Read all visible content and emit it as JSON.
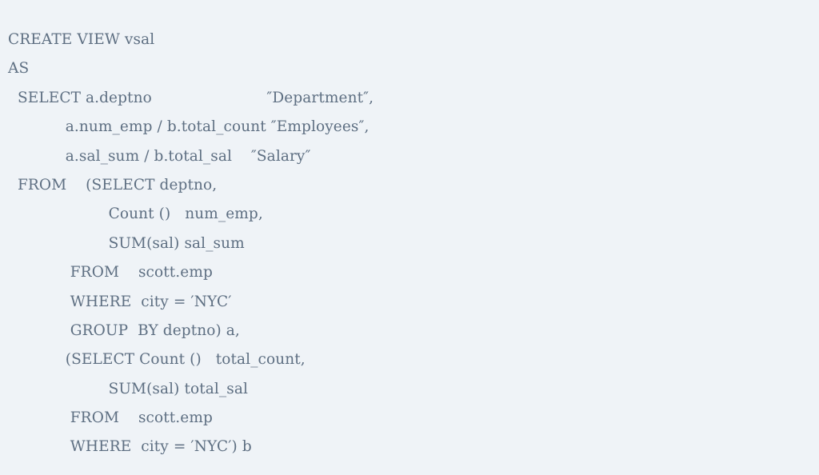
{
  "document": {
    "kind": "sql-code-listing",
    "language": "SQL",
    "background_color": "#eff3f7",
    "text_color": "#5e6f82",
    "statement_name": "vsal",
    "line_count": 15
  },
  "code": {
    "lines": [
      "CREATE VIEW vsal",
      "AS",
      "  SELECT a.deptno                        ″Department″,",
      "            a.num_emp / b.total_count ″Employees″,",
      "            a.sal_sum / b.total_sal    ″Salary″",
      "  FROM    (SELECT deptno,",
      "                     Count ()   num_emp,",
      "                     SUM(sal) sal_sum",
      "             FROM    scott.emp",
      "             WHERE  city = ′NYC′",
      "             GROUP  BY deptno) a,",
      "            (SELECT Count ()   total_count,",
      "                     SUM(sal) total_sal",
      "             FROM    scott.emp",
      "             WHERE  city = ′NYC′) b"
    ],
    "keywords": [
      "CREATE",
      "VIEW",
      "AS",
      "SELECT",
      "FROM",
      "WHERE",
      "GROUP",
      "BY"
    ],
    "functions": [
      "Count",
      "SUM"
    ],
    "identifiers": [
      "vsal",
      "a.deptno",
      "a.num_emp",
      "b.total_count",
      "a.sal_sum",
      "b.total_sal",
      "deptno",
      "num_emp",
      "sal_sum",
      "total_count",
      "total_sal",
      "scott.emp",
      "city",
      "sal",
      "a",
      "b"
    ],
    "column_aliases": [
      "Department",
      "Employees",
      "Salary"
    ],
    "literals": [
      "NYC"
    ]
  }
}
